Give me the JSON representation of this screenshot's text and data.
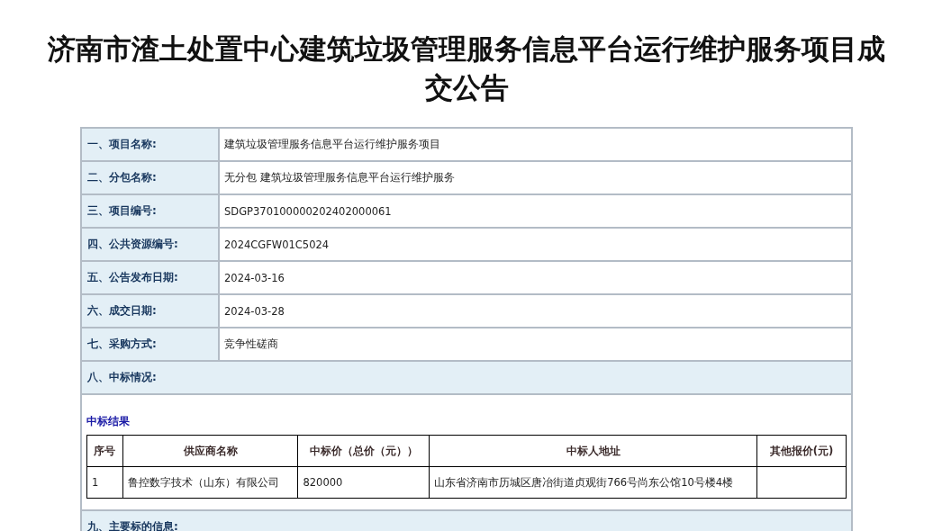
{
  "title": "济南市渣土处置中心建筑垃圾管理服务信息平台运行维护服务项目成交公告",
  "fields": [
    {
      "label": "一、项目名称:",
      "value": "建筑垃圾管理服务信息平台运行维护服务项目"
    },
    {
      "label": "二、分包名称:",
      "value": "无分包 建筑垃圾管理服务信息平台运行维护服务"
    },
    {
      "label": "三、项目编号:",
      "value": "SDGP370100000202402000061"
    },
    {
      "label": "四、公共资源编号:",
      "value": "2024CGFW01C5024"
    },
    {
      "label": "五、公告发布日期:",
      "value": "2024-03-16"
    },
    {
      "label": "六、成交日期:",
      "value": "2024-03-28"
    },
    {
      "label": "七、采购方式:",
      "value": "竞争性磋商"
    }
  ],
  "award_section": {
    "label": "八、中标情况:",
    "result_heading": "中标结果",
    "columns": [
      "序号",
      "供应商名称",
      "中标价（总价（元））",
      "中标人地址",
      "其他报价(元)"
    ],
    "rows": [
      [
        "1",
        "鲁控数字技术（山东）有限公司",
        "820000",
        "山东省济南市历城区唐冶街道贞观街766号尚东公馆10号楼4楼",
        ""
      ]
    ]
  },
  "next_section": {
    "label": "九、主要标的信息:"
  }
}
